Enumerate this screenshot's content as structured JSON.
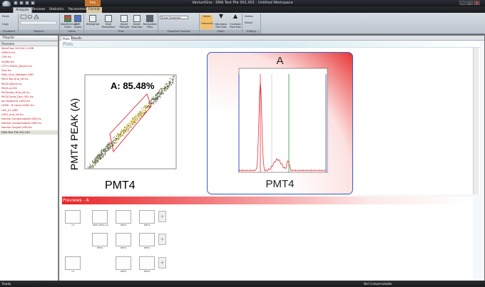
{
  "window": {
    "title": "VenturiOne - DNA Test File 001.001 - Untitled Workspace",
    "ctx_tab": "Plot",
    "min": "_",
    "max": "□",
    "close": "X"
  },
  "quick_access": [
    "S",
    "↶",
    "↷",
    "▾"
  ],
  "tabs": [
    "Analysis",
    "Reviews",
    "Statistics",
    "Parameters",
    "Format"
  ],
  "ribbon": {
    "groups": [
      "Clipboard",
      "Regions",
      "Gates",
      "Plots",
      "Snapshot Overlap",
      "Zoom",
      "Editing"
    ],
    "buttons": {
      "paste": "Paste",
      "copy": "Copy",
      "new_order": "New/Arrange Order",
      "edit_gates": "Edit Gates",
      "histogram": "Histogram",
      "dual_param": "Dual Parameter",
      "upper_triangle": "Upper Triangle",
      "zoom_overlays": "Zoom Overlays",
      "backgated": "Backgated Plots",
      "gates": "Gates",
      "hierarchy": "Hierarchy",
      "decrease": "Decrease Plot Size",
      "increase": "Increase Plot Size",
      "delete": "Delete",
      "select": "Select"
    },
    "view_dropdown": "Show Snapshot"
  },
  "playlist": {
    "title": "Playlist",
    "column": "Filename",
    "files": [
      "WorkFlow 100 file 1.LMD",
      "GM001.fcs",
      "C09.fcs",
      "0x4Ro.fcs",
      "CYTO-R3$SI_(NA)20.fcs",
      "Dna.fcs",
      "EBm_Dna_Software.LMD",
      "PACS Bla Dna_v6.fcs",
      "PACSCalibur.fcs",
      "PACSun.001",
      "PACSonto_Dna_v6.fcs",
      "PACSCanto_Dna_002.fcs",
      "Jan Segment LSR2.fcs",
      "LSRIII - 8 Colors 0000.fcs",
      "LSR_21.LMD",
      "LSR2_dna_v6.fcs",
      "Normal Compensated LMD.fcs",
      "Normal Compensated LMD.fcs",
      "Normal Singlet LMD.fcs",
      "DNA Test File 001.001"
    ],
    "selected_index": 19
  },
  "work_tabs": [
    "Plots",
    "Results"
  ],
  "plots_label": "Plots",
  "dot_plot": {
    "gate_label": "A: 85.48%",
    "x_axis": "PMT4",
    "y_axis": "PMT4 PEAK (A)",
    "gate_color": "#d9232b"
  },
  "histogram": {
    "title": "A",
    "x_axis": "PMT4",
    "colors": {
      "red": "#e2323a",
      "blue": "#2c43d6",
      "green": "#2b9a3b"
    }
  },
  "previews_label": "Previews - A",
  "thumbnails": [
    {
      "label": "Y4"
    },
    {
      "label": "PMT4 PEAK (A)"
    },
    {
      "label": "PMT4"
    },
    {
      "label": "PMT4"
    },
    {
      "label": "PMT4"
    },
    {
      "label": "PMT4"
    },
    {
      "label": "PMT4"
    },
    {
      "label": "Y4"
    },
    {
      "label": "PMT4"
    },
    {
      "label": "PMT4"
    }
  ],
  "plus_symbol": "+",
  "status": {
    "left": "Ready",
    "center": "Not Compensatable"
  }
}
